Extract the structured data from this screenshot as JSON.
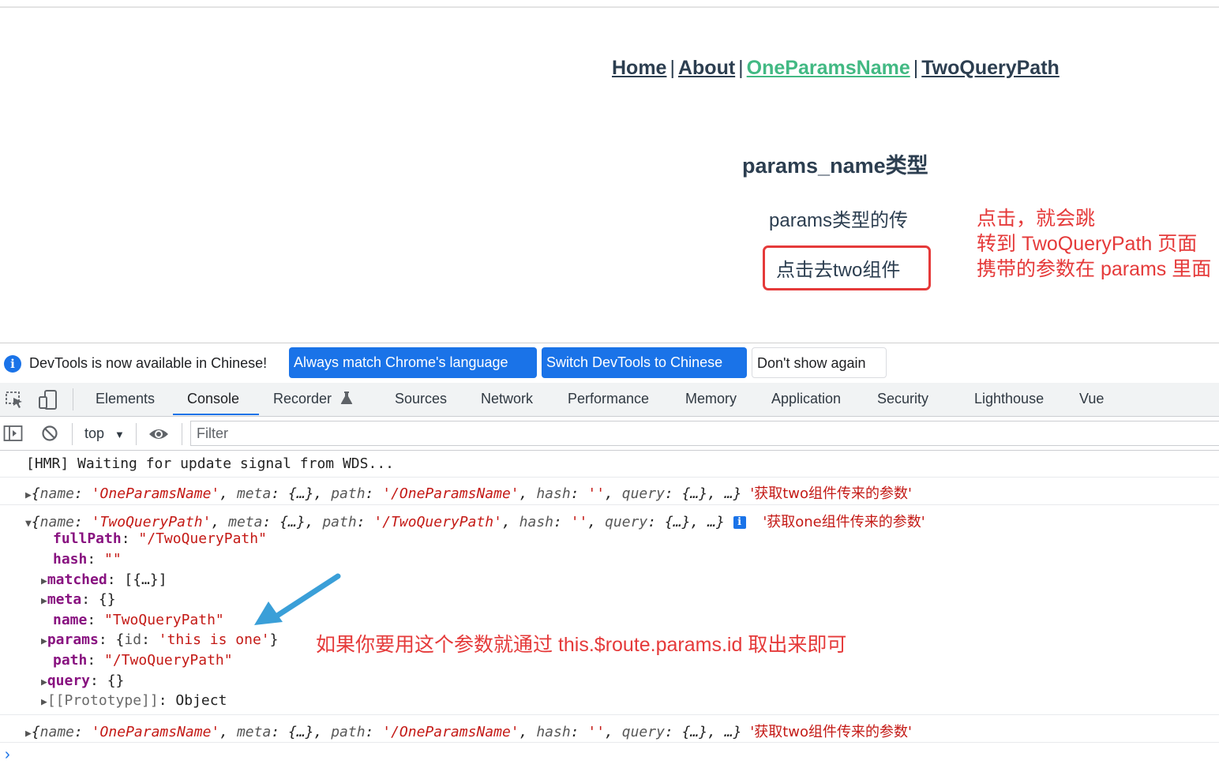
{
  "nav": {
    "items": [
      {
        "label": "Home"
      },
      {
        "label": "About"
      },
      {
        "label": "OneParamsName"
      },
      {
        "label": "TwoQueryPath"
      }
    ],
    "separator": "|"
  },
  "page": {
    "title": "params_name类型",
    "text": "params类型的传",
    "button_label": "点击去two组件"
  },
  "annotations": {
    "right_note": [
      "点击，就会跳",
      "转到 TwoQueryPath 页面",
      "携带的参数在 params 里面"
    ],
    "console_note": "如果你要用这个参数就通过  this.$route.params.id   取出来即可"
  },
  "colors": {
    "annotation": "#e53a3a",
    "active_link": "#42b983",
    "devtools_blue": "#1a73e8"
  },
  "infobar": {
    "message": "DevTools is now available in Chinese!",
    "btn_match": "Always match Chrome's language",
    "btn_switch": "Switch DevTools to Chinese",
    "btn_dismiss": "Don't show again",
    "icon": "info-icon"
  },
  "devtools": {
    "tabs": [
      "Elements",
      "Console",
      "Recorder",
      "Sources",
      "Network",
      "Performance",
      "Memory",
      "Application",
      "Security",
      "Lighthouse",
      "Vue"
    ],
    "active_tab": "Console",
    "context": "top",
    "filter_placeholder": "Filter"
  },
  "console": {
    "hmr": "[HMR] Waiting for update signal from WDS...",
    "entry1": {
      "name": "'OneParamsName'",
      "path": "'/OneParamsName'",
      "hash": "''",
      "comment": "'获取two组件传来的参数'"
    },
    "entry2": {
      "name": "'TwoQueryPath'",
      "path": "'/TwoQueryPath'",
      "hash": "''",
      "comment": "'获取one组件传来的参数'",
      "props": {
        "fullPath": "\"/TwoQueryPath\"",
        "hash": "\"\"",
        "matched": "[{…}]",
        "meta": "{}",
        "name": "\"TwoQueryPath\"",
        "params_id": "'this is one'",
        "path": "\"/TwoQueryPath\"",
        "query": "{}",
        "prototype": "Object"
      }
    },
    "entry3": {
      "name": "'OneParamsName'",
      "path": "'/OneParamsName'",
      "hash": "''",
      "comment": "'获取two组件传来的参数'"
    }
  }
}
